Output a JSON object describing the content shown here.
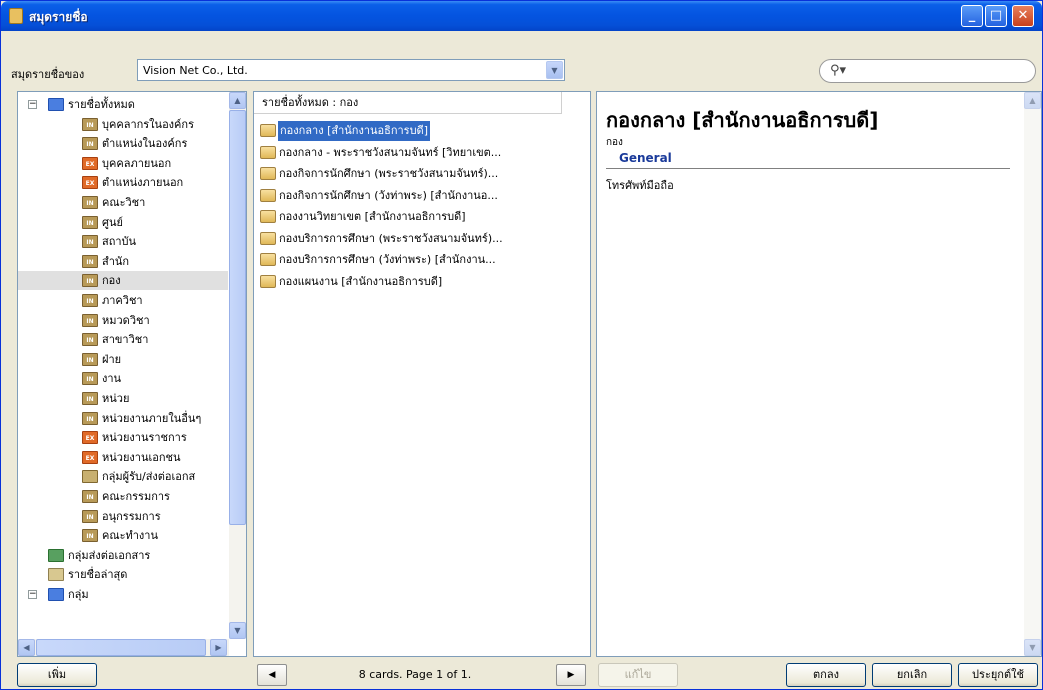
{
  "window": {
    "title": "สมุดรายชื่อ",
    "minimize_icon": "minimize-icon",
    "maximize_icon": "maximize-icon",
    "close_icon": "close-icon"
  },
  "owner": {
    "label": "สมุดรายชื่อของ",
    "value": "Vision Net Co., Ltd."
  },
  "search": {
    "icon": "search-icon",
    "value": ""
  },
  "tree": {
    "items": [
      {
        "label": "รายชื่อทั้งหมด",
        "icon": "address-book-icon",
        "expanded": true
      },
      {
        "label": "บุคคลากรในองค์กร",
        "icon": "internal-icon"
      },
      {
        "label": "ตำแหน่งในองค์กร",
        "icon": "internal-icon"
      },
      {
        "label": "บุคคลภายนอก",
        "icon": "external-icon"
      },
      {
        "label": "ตำแหน่งภายนอก",
        "icon": "external-icon"
      },
      {
        "label": "คณะวิชา",
        "icon": "internal-icon"
      },
      {
        "label": "ศูนย์",
        "icon": "internal-icon"
      },
      {
        "label": "สถาบัน",
        "icon": "internal-icon"
      },
      {
        "label": "สำนัก",
        "icon": "internal-icon"
      },
      {
        "label": "กอง",
        "icon": "internal-icon",
        "selected": true
      },
      {
        "label": "ภาควิชา",
        "icon": "internal-icon"
      },
      {
        "label": "หมวดวิชา",
        "icon": "internal-icon"
      },
      {
        "label": "สาขาวิชา",
        "icon": "internal-icon"
      },
      {
        "label": "ฝ่าย",
        "icon": "internal-icon"
      },
      {
        "label": "งาน",
        "icon": "internal-icon"
      },
      {
        "label": "หน่วย",
        "icon": "internal-icon"
      },
      {
        "label": "หน่วยงานภายในอื่นๆ",
        "icon": "internal-icon"
      },
      {
        "label": "หน่วยงานราชการ",
        "icon": "external-icon"
      },
      {
        "label": "หน่วยงานเอกชน",
        "icon": "external-icon"
      },
      {
        "label": "กลุ่มผู้รับ/ส่งต่อเอกส",
        "icon": "shared-group-icon"
      },
      {
        "label": "คณะกรรมการ",
        "icon": "internal-icon"
      },
      {
        "label": "อนุกรรมการ",
        "icon": "internal-icon"
      },
      {
        "label": "คณะทำงาน",
        "icon": "internal-icon"
      },
      {
        "label": "กลุ่มส่งต่อเอกสาร",
        "icon": "forward-group-icon"
      },
      {
        "label": "รายชื่อล่าสุด",
        "icon": "recent-icon"
      },
      {
        "label": "กลุ่ม",
        "icon": "group-icon"
      }
    ]
  },
  "list": {
    "header": "รายชื่อทั้งหมด : กอง",
    "cards": [
      "กองกลาง [สำนักงานอธิการบดี]",
      "กองกลาง - พระราชวังสนามจันทร์ [วิทยาเขต...",
      "กองกิจการนักศึกษา (พระราชวังสนามจันทร์)...",
      "กองกิจการนักศึกษา (วังท่าพระ) [สำนักงานอ...",
      "กองงานวิทยาเขต [สำนักงานอธิการบดี]",
      "กองบริการการศึกษา (พระราชวังสนามจันทร์)...",
      "กองบริการการศึกษา (วังท่าพระ) [สำนักงาน...",
      "กองแผนงาน [สำนักงานอธิการบดี]"
    ],
    "selected_index": 0
  },
  "detail": {
    "title": "กองกลาง [สำนักงานอธิการบดี]",
    "subtitle": "กอง",
    "section": "General",
    "field_label": "โทรศัพท์มือถือ"
  },
  "footer": {
    "add_label": "เพิ่ม",
    "page_status": "8 cards. Page 1 of 1.",
    "edit_label": "แก้ไข",
    "ok_label": "ตกลง",
    "cancel_label": "ยกเลิก",
    "apply_label": "ประยุกต์ใช้"
  },
  "colors": {
    "titlebar": "#0454e0",
    "selection": "#316ac5",
    "section_heading": "#1a3a9a"
  }
}
